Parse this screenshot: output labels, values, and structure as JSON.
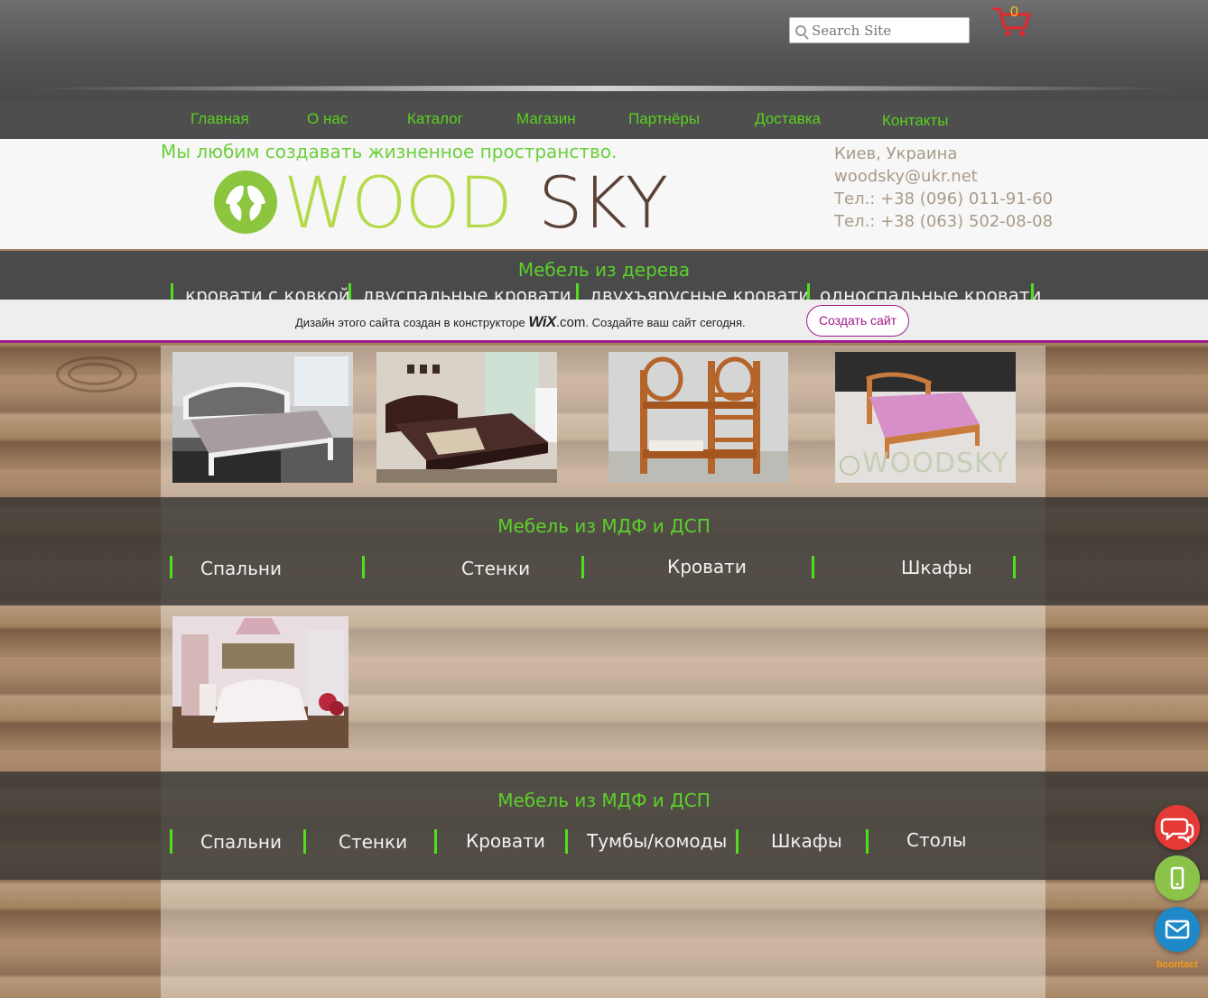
{
  "header": {
    "search_placeholder": "Search Site",
    "cart_count": "0"
  },
  "nav": [
    "Главная",
    "О нас",
    "Каталог",
    "Магазин",
    "Партнёры",
    "Доставка",
    "Контакты"
  ],
  "brand": {
    "slogan": "Мы любим создавать жизненное пространство.",
    "logo_text_wood": "WOOD",
    "logo_text_sky": "SKY",
    "contacts": [
      "Киев, Украина",
      "woodsky@ukr.net",
      "Тел.: +38 (096) 011-91-60",
      "Тел.: +38 (063) 502-08-08"
    ]
  },
  "wood_section": {
    "title": "Мебель из дерева",
    "categories": [
      "кровати с ковкой",
      "двуспальные кровати",
      "двухъярусные кровати",
      "односпальные кровати"
    ]
  },
  "wix_banner": {
    "text_before": "Дизайн этого сайта создан в конструкторе",
    "wix_logo": "WiX",
    "wix_domain": ".com",
    "text_after": ". Создайте ваш сайт сегодня.",
    "button": "Создать сайт"
  },
  "mdf_section_1": {
    "title": "Мебель из МДФ и ДСП",
    "categories": [
      "Спальни",
      "Стенки",
      "Кровати",
      "Шкафы"
    ]
  },
  "mdf_section_2": {
    "title": "Мебель из МДФ и ДСП",
    "categories": [
      "Спальни",
      "Стенки",
      "Кровати",
      "Тумбы/комоды",
      "Шкафы",
      "Столы"
    ]
  },
  "product_images": [
    "white-bed",
    "dark-bed",
    "bunk-bed",
    "pink-bed",
    "bedroom-set"
  ],
  "watermark": "WOODSKY",
  "widget": {
    "brand": "bcontact",
    "buttons": [
      "chat-icon",
      "phone-icon",
      "mail-icon"
    ]
  },
  "colors": {
    "accent_green": "#58d11e",
    "wix_purple": "#a0198c",
    "cart_red": "#e5262a"
  }
}
